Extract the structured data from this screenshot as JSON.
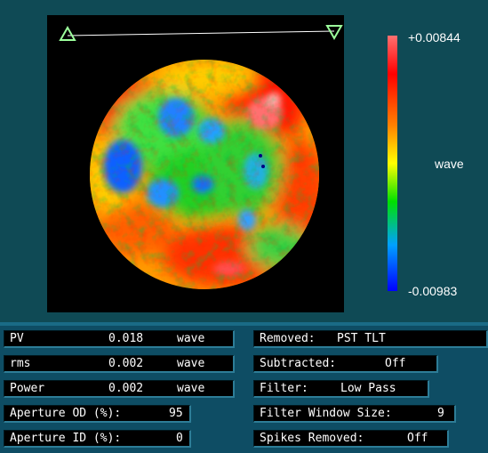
{
  "colorbar": {
    "max_label": "+0.00844",
    "min_label": "-0.00983",
    "unit": "wave",
    "colors": [
      "#ff7070",
      "#ff0000",
      "#ff8000",
      "#ffff00",
      "#00e000",
      "#00a0ff",
      "#0000ff"
    ]
  },
  "stats": {
    "pv": {
      "label": "PV",
      "value": "0.018",
      "unit": "wave"
    },
    "rms": {
      "label": "rms",
      "value": "0.002",
      "unit": "wave"
    },
    "power": {
      "label": "Power",
      "value": "0.002",
      "unit": "wave"
    },
    "aperture_od": {
      "label": "Aperture OD (%):",
      "value": "95"
    },
    "aperture_id": {
      "label": "Aperture ID (%):",
      "value": "0"
    }
  },
  "settings": {
    "removed": {
      "label": "Removed:",
      "value": "PST TLT"
    },
    "subtracted": {
      "label": "Subtracted:",
      "value": "Off"
    },
    "filter": {
      "label": "Filter:",
      "value": "Low Pass"
    },
    "filter_window": {
      "label": "Filter Window Size:",
      "value": "9"
    },
    "spikes": {
      "label": "Spikes Removed:",
      "value": "Off"
    }
  }
}
